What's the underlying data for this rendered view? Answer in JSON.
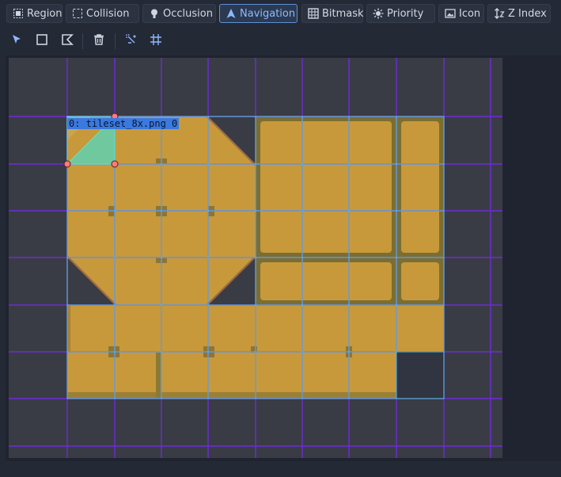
{
  "toolbar": {
    "modes": [
      {
        "label": "Region",
        "icon": "region-icon"
      },
      {
        "label": "Collision",
        "icon": "collision-icon"
      },
      {
        "label": "Occlusion",
        "icon": "occlusion-icon"
      },
      {
        "label": "Navigation",
        "icon": "navigation-icon",
        "active": true
      },
      {
        "label": "Bitmask",
        "icon": "bitmask-icon"
      },
      {
        "label": "Priority",
        "icon": "priority-icon"
      },
      {
        "label": "Icon",
        "icon": "icon-mode-icon"
      },
      {
        "label": "Z Index",
        "icon": "z-index-icon"
      }
    ]
  },
  "tools": [
    "select-tool-icon",
    "rectangle-tool-icon",
    "polygon-tool-icon",
    "delete-icon",
    "keep-inside-tile-icon",
    "grid-snap-icon"
  ],
  "editor": {
    "tile_label": "0: tileset_8x.png 0"
  },
  "colors": {
    "accent": "#5e8fd6",
    "grid": "#6f2bd8",
    "tile_outline": "#5ec8e0",
    "navigation_fill": "#5fd0b0",
    "handle": "#ff7a7a"
  }
}
